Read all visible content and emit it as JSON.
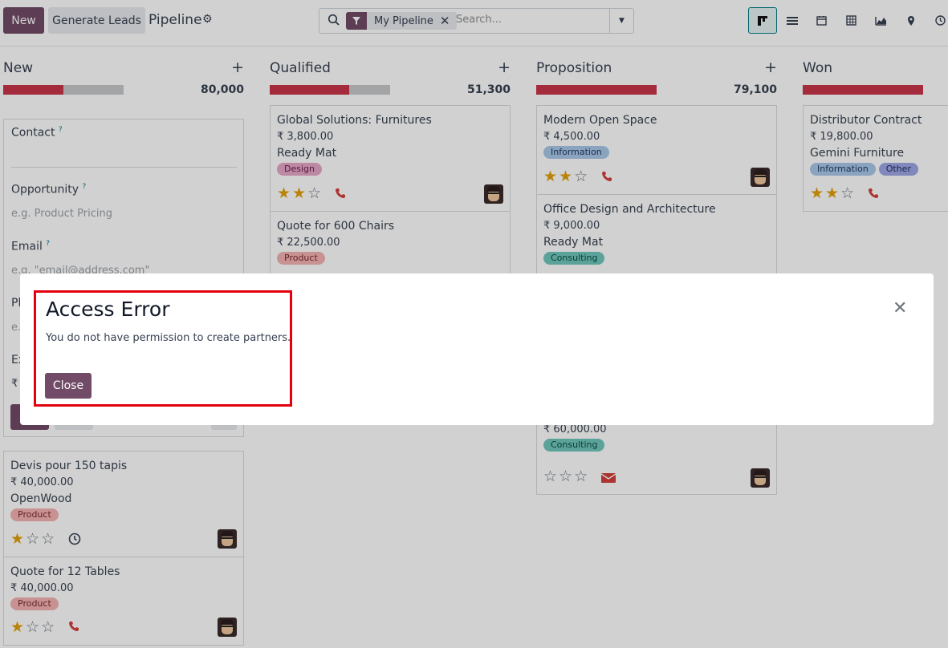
{
  "control_panel": {
    "new_label": "New",
    "generate_label": "Generate Leads",
    "breadcrumb_title": "Pipeline",
    "search": {
      "facet_label": "My Pipeline",
      "placeholder": "Search..."
    },
    "views": [
      "kanban-icon",
      "list-icon",
      "calendar-icon",
      "pivot-icon",
      "graph-icon",
      "map-icon",
      "activity-icon"
    ]
  },
  "columns": [
    {
      "title": "New",
      "total": "80,000",
      "progress": 0.5,
      "quick_create": {
        "contact_label": "Contact",
        "opportunity_label": "Opportunity",
        "opportunity_placeholder": "e.g. Product Pricing",
        "email_label": "Email",
        "email_placeholder": "e.g. \"email@address.com\"",
        "phone_label": "Ph",
        "phone_placeholder": "e.",
        "expected_label": "Ex",
        "expected_value": "₹"
      },
      "cards": [
        {
          "title": "Devis pour 150 tapis",
          "amount": "₹ 40,000.00",
          "company": "OpenWood",
          "tags": [
            "Product"
          ],
          "stars": 1,
          "activity": "clock-icon"
        },
        {
          "title": "Quote for 12 Tables",
          "amount": "₹ 40,000.00",
          "company": "",
          "tags": [
            "Product"
          ],
          "stars": 1,
          "activity": "phone-icon"
        }
      ]
    },
    {
      "title": "Qualified",
      "total": "51,300",
      "progress": 0.66,
      "cards": [
        {
          "title": "Global Solutions: Furnitures",
          "amount": "₹ 3,800.00",
          "company": "Ready Mat",
          "tags": [
            "Design"
          ],
          "stars": 2,
          "activity": "phone-icon"
        },
        {
          "title": "Quote for 600 Chairs",
          "amount": "₹ 22,500.00",
          "company": "",
          "tags": [
            "Product"
          ]
        }
      ]
    },
    {
      "title": "Proposition",
      "total": "79,100",
      "progress": 1.0,
      "cards": [
        {
          "title": "Modern Open Space",
          "amount": "₹ 4,500.00",
          "company": "",
          "tags": [
            "Information"
          ],
          "stars": 2,
          "activity": "phone-icon"
        },
        {
          "title": "Office Design and Architecture",
          "amount": "₹ 9,000.00",
          "company": "Ready Mat",
          "tags": [
            "Consulting"
          ]
        },
        {
          "title": "",
          "amount": "₹ 60,000.00",
          "company": "",
          "tags": [
            "Consulting"
          ],
          "stars": 0,
          "activity": "email-icon"
        }
      ]
    },
    {
      "title": "Won",
      "total": "",
      "progress": 1.0,
      "cards": [
        {
          "title": "Distributor Contract",
          "amount": "₹ 19,800.00",
          "company": "Gemini Furniture",
          "tags": [
            "Information",
            "Other"
          ],
          "stars": 2,
          "activity": "phone-icon"
        }
      ]
    }
  ],
  "tag_colors": {
    "Product": "#f5b3b3",
    "Design": "#e7a6c9",
    "Information": "#a9c7ea",
    "Consulting": "#70c7bc",
    "Other": "#9da7e6"
  },
  "dialog": {
    "title": "Access Error",
    "message": "You do not have permission to create partners.",
    "close_label": "Close"
  }
}
